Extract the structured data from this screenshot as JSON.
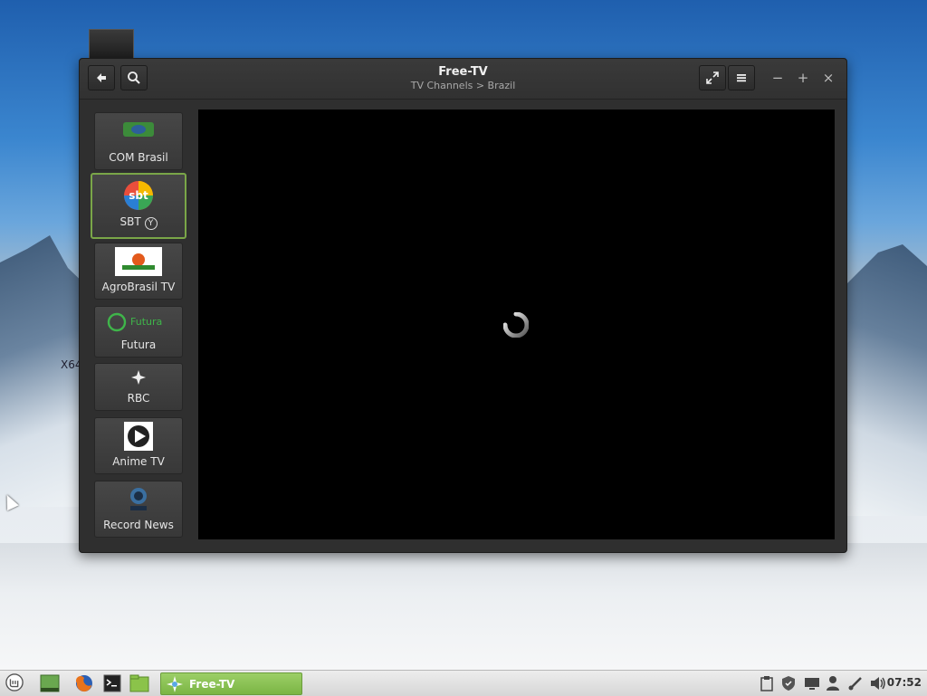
{
  "desktop": {
    "partial_label": "X64"
  },
  "window": {
    "title": "Free-TV",
    "subtitle": "TV Channels > Brazil",
    "buttons": {
      "back": "back-icon",
      "search": "search-icon",
      "fullscreen": "fullscreen-icon",
      "menu": "menu-icon",
      "minimize": "−",
      "maximize": "+",
      "close": "×"
    }
  },
  "channels": [
    {
      "label": "COM Brasil"
    },
    {
      "label": "SBT",
      "badge": "Y",
      "selected": true
    },
    {
      "label": "AgroBrasil TV"
    },
    {
      "label": "Futura",
      "logo_text": "Futura"
    },
    {
      "label": "RBC"
    },
    {
      "label": "Anime TV"
    },
    {
      "label": "Record News"
    }
  ],
  "player": {
    "state": "loading"
  },
  "taskbar": {
    "active_task": "Free-TV",
    "clock": "07:52"
  },
  "colors": {
    "selection_border": "#7aa648",
    "taskbar_active": "#8cc256",
    "window_bg": "#2f2f2f"
  }
}
